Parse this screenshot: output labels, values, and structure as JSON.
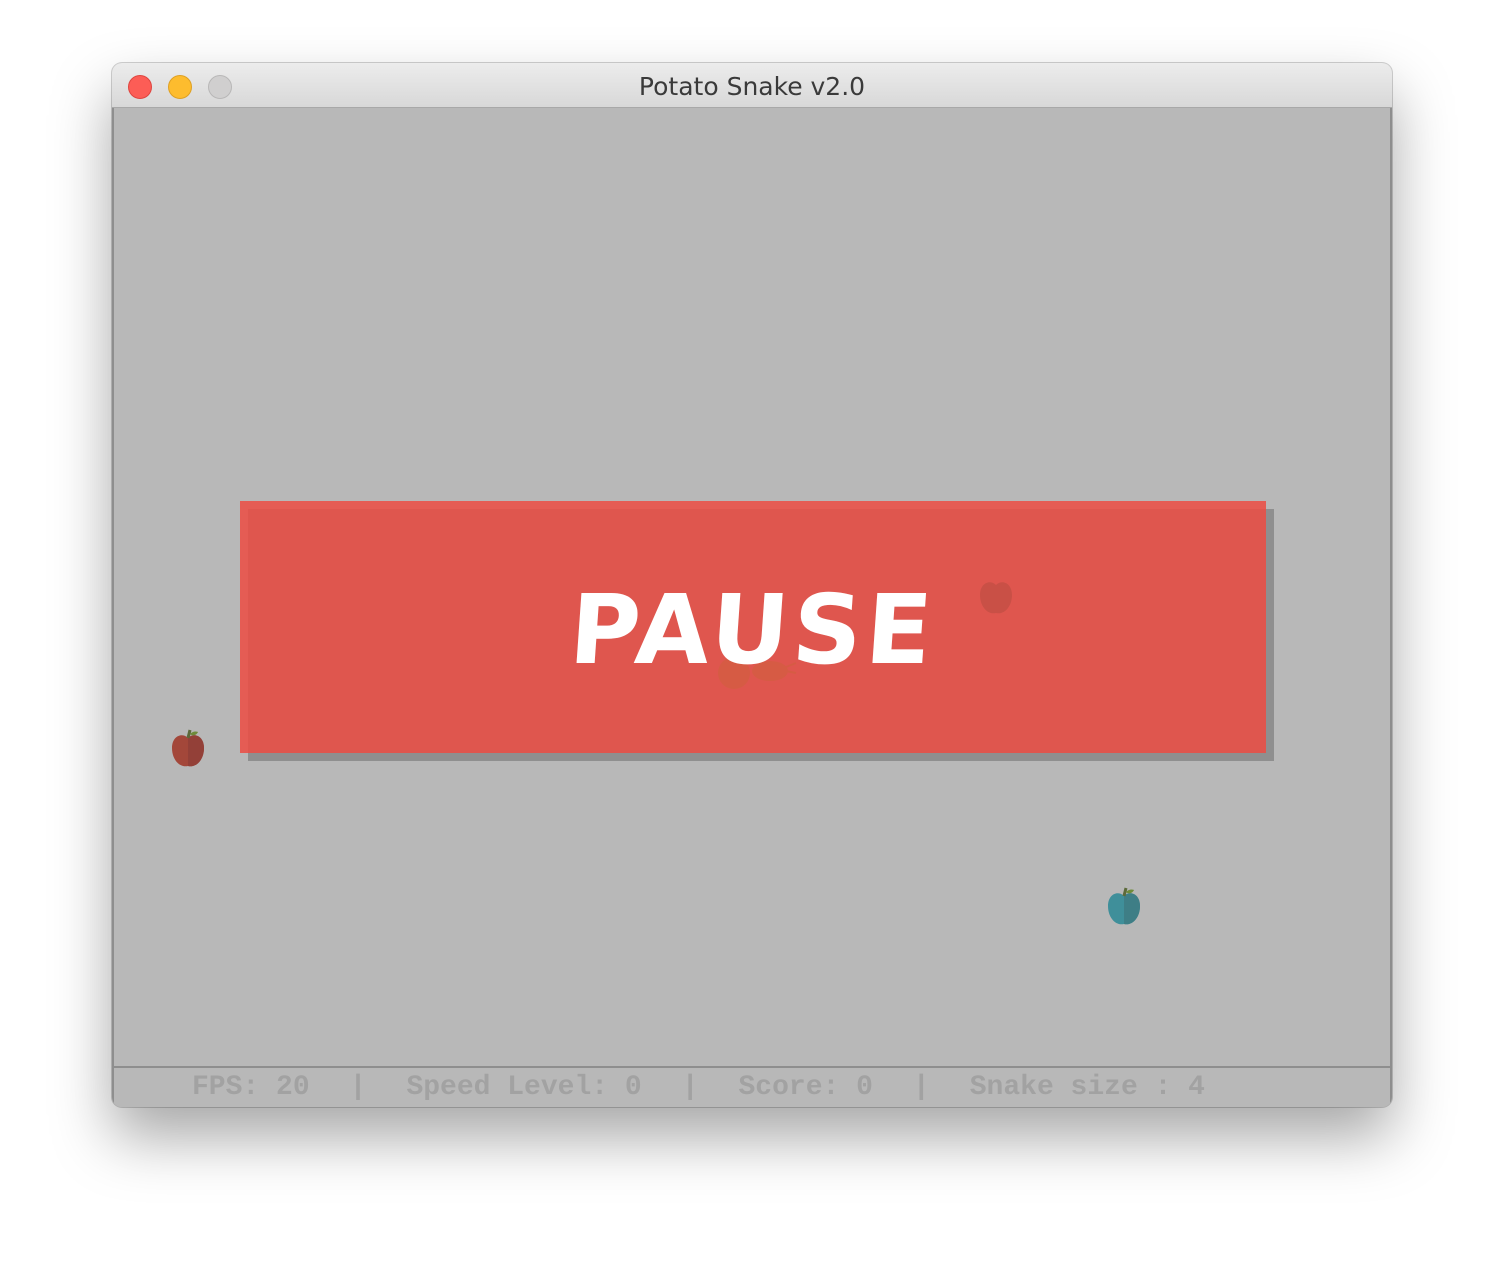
{
  "window": {
    "title": "Potato Snake v2.0"
  },
  "game": {
    "pause_label": "PAUSE",
    "items": [
      {
        "name": "red-apple-icon",
        "color": "#a3473a"
      },
      {
        "name": "red-apple-icon",
        "color": "#c24a40"
      },
      {
        "name": "teal-apple-icon",
        "color": "#3f8f9a"
      }
    ]
  },
  "status": {
    "fps": "FPS: 20",
    "speed": "Speed Level: 0",
    "score": "Score: 0",
    "size": "Snake size : 4",
    "separator": "|"
  },
  "colors": {
    "pause_panel": "#ea4f46",
    "board": "#b8b8b8",
    "status_text": "#a2a2a2"
  }
}
